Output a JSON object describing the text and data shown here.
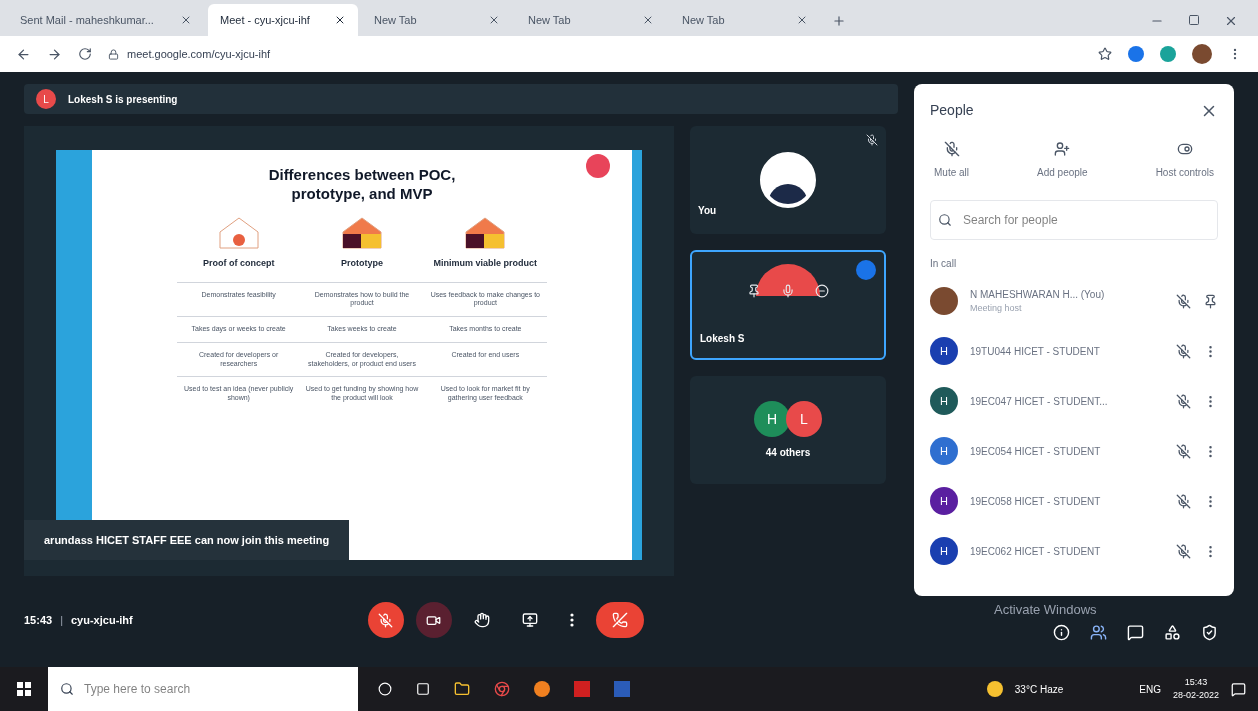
{
  "browser": {
    "tabs": [
      {
        "title": "Sent Mail - maheshkumar...",
        "selected": false
      },
      {
        "title": "Meet - cyu-xjcu-ihf",
        "selected": true
      },
      {
        "title": "New Tab",
        "selected": false
      },
      {
        "title": "New Tab",
        "selected": false
      },
      {
        "title": "New Tab",
        "selected": false
      }
    ],
    "url": "meet.google.com/cyu-xjcu-ihf"
  },
  "presenting": {
    "initial": "L",
    "text": "Lokesh S is presenting"
  },
  "slide": {
    "title": "Differences between POC, prototype, and MVP",
    "columns": [
      "Proof of concept",
      "Prototype",
      "Minimum viable product"
    ],
    "rows": [
      [
        "Demonstrates feasibility",
        "Demonstrates how to build the product",
        "Uses feedback to make changes to product"
      ],
      [
        "Takes days or weeks to create",
        "Takes weeks to create",
        "Takes months to create"
      ],
      [
        "Created for developers or researchers",
        "Created for developers, stakeholders, or product end users",
        "Created for end users"
      ],
      [
        "Used to test an idea (never publicly shown)",
        "Used to get funding by showing how the product will look",
        "Used to look for market fit by gathering user feedback"
      ]
    ]
  },
  "toast": "arundass HICET STAFF EEE can now join this meeting",
  "tiles": [
    {
      "kind": "self",
      "name": "You"
    },
    {
      "kind": "speaker",
      "name": "Lokesh S",
      "selected": true
    },
    {
      "kind": "others",
      "initials": [
        {
          "letter": "H",
          "color": "#1e8e5a"
        },
        {
          "letter": "L",
          "color": "#e84a4a"
        }
      ],
      "name": "44 others"
    }
  ],
  "people": {
    "title": "People",
    "actions": [
      "Mute all",
      "Add people",
      "Host controls"
    ],
    "search_placeholder": "Search for people",
    "section": "In call",
    "participants": [
      {
        "name": "N MAHESHWARAN H... (You)",
        "subtitle": "Meeting host",
        "kind": "photo"
      },
      {
        "name": "19TU044 HICET - STUDENT",
        "initial": "H",
        "color": "#1a3fb0",
        "kind": "letter"
      },
      {
        "name": "19EC047 HICET - STUDENT...",
        "initial": "H",
        "color": "#1f5a5a",
        "kind": "letter"
      },
      {
        "name": "19EC054 HICET - STUDENT",
        "initial": "H",
        "color": "#2f6fd0",
        "kind": "letter"
      },
      {
        "name": "19EC058 HICET - STUDENT",
        "initial": "H",
        "color": "#5a1fa0",
        "kind": "letter"
      },
      {
        "name": "19EC062 HICET - STUDENT",
        "initial": "H",
        "color": "#1a3fb0",
        "kind": "letter"
      }
    ]
  },
  "meeting": {
    "time": "15:43",
    "separator": "|",
    "code": "cyu-xjcu-ihf"
  },
  "watermark": "Activate Windows",
  "taskbar": {
    "search_placeholder": "Type here to search",
    "weather": "33°C Haze",
    "lang": "ENG",
    "time": "15:43",
    "date": "28-02-2022"
  }
}
